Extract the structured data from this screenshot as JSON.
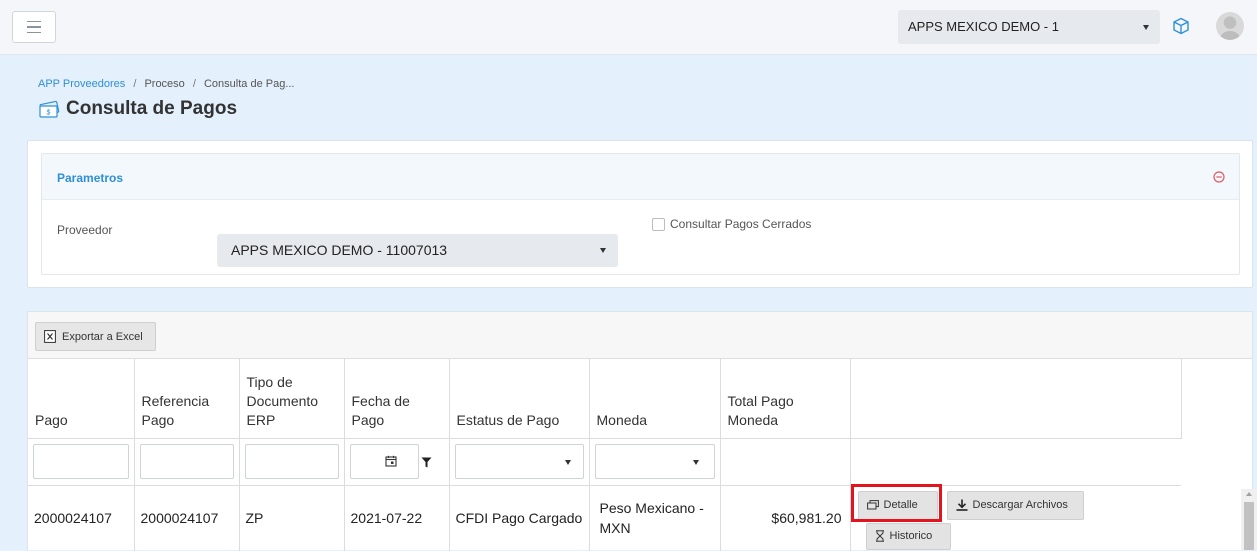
{
  "header": {
    "company_select": "APPS MEXICO DEMO - 1"
  },
  "breadcrumb": {
    "items": [
      "APP Proveedores",
      "Proceso",
      "Consulta de Pag..."
    ],
    "separator": "/"
  },
  "page": {
    "title": "Consulta de Pagos"
  },
  "params": {
    "title": "Parametros",
    "proveedor_label": "Proveedor",
    "proveedor_value": "APPS MEXICO DEMO - 11007013",
    "checkbox_label": "Consultar Pagos Cerrados",
    "checkbox_checked": false
  },
  "toolbar": {
    "export_label": "Exportar a Excel"
  },
  "columns": [
    [
      "Pago"
    ],
    [
      "Referencia",
      "Pago"
    ],
    [
      "Tipo de",
      "Documento",
      "ERP"
    ],
    [
      "Fecha de",
      "Pago"
    ],
    [
      "Estatus de Pago"
    ],
    [
      "Moneda"
    ],
    [
      "Total Pago",
      "Moneda"
    ],
    [
      ""
    ]
  ],
  "rows": [
    {
      "pago": "2000024107",
      "referencia": "2000024107",
      "tipo": "ZP",
      "fecha": "2021-07-22",
      "estatus": "CFDI Pago Cargado",
      "moneda": [
        "Peso Mexicano -",
        "MXN"
      ],
      "total": "$60,981.20",
      "actions": {
        "detalle": "Detalle",
        "descargar": "Descargar Archivos",
        "historico": "Historico"
      }
    }
  ],
  "colors": {
    "accent": "#2f8fd8",
    "highlight": "#e3141d",
    "danger": "#e05a66"
  }
}
